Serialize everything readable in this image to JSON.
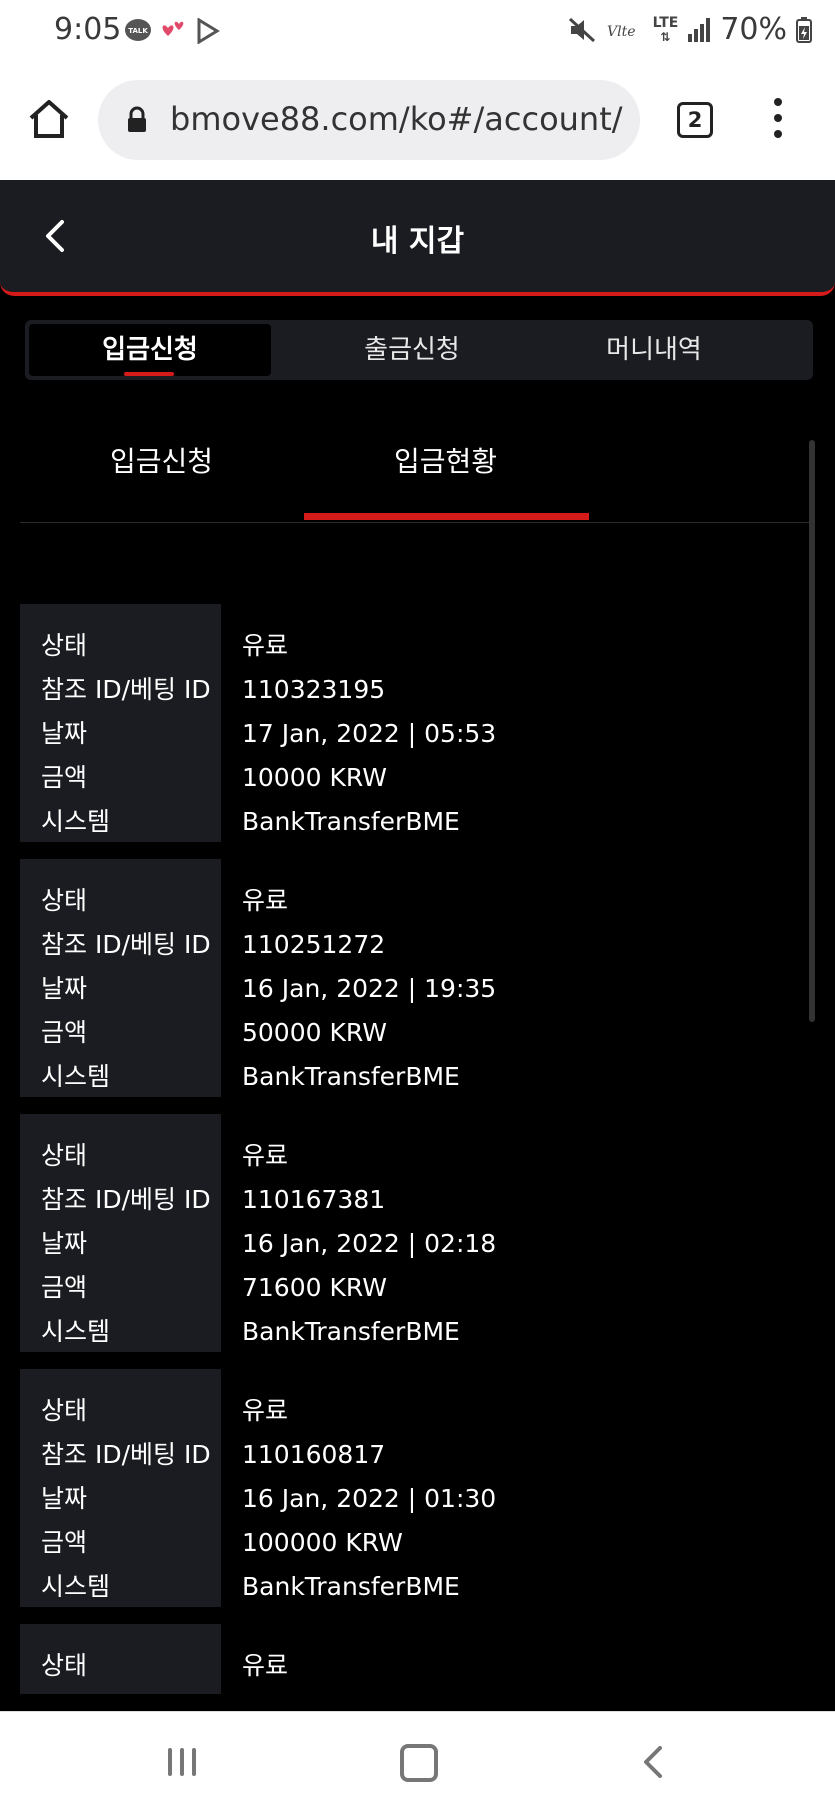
{
  "status_bar": {
    "time": "9:05",
    "battery": "70%",
    "network": "LTE",
    "talk_label": "TALK"
  },
  "browser": {
    "url": "bmove88.com/ko#/account/",
    "tab_count": "2"
  },
  "header": {
    "title": "내 지갑"
  },
  "main_tabs": [
    {
      "label": "입금신청",
      "active": true
    },
    {
      "label": "출금신청",
      "active": false
    },
    {
      "label": "머니내역",
      "active": false
    }
  ],
  "sub_tabs": [
    {
      "label": "입금신청",
      "active": false
    },
    {
      "label": "입금현황",
      "active": true
    }
  ],
  "field_labels": {
    "status": "상태",
    "ref_id": "참조 ID/베팅 ID",
    "date": "날짜",
    "amount": "금액",
    "system": "시스템"
  },
  "records": [
    {
      "status": "유료",
      "ref_id": "110323195",
      "date": "17 Jan, 2022 | 05:53",
      "amount": "10000 KRW",
      "system": "BankTransferBME"
    },
    {
      "status": "유료",
      "ref_id": "110251272",
      "date": "16 Jan, 2022 | 19:35",
      "amount": "50000 KRW",
      "system": "BankTransferBME"
    },
    {
      "status": "유료",
      "ref_id": "110167381",
      "date": "16 Jan, 2022 | 02:18",
      "amount": "71600 KRW",
      "system": "BankTransferBME"
    },
    {
      "status": "유료",
      "ref_id": "110160817",
      "date": "16 Jan, 2022 | 01:30",
      "amount": "100000 KRW",
      "system": "BankTransferBME"
    },
    {
      "status": "유료"
    }
  ],
  "colors": {
    "accent": "#d51a1a",
    "panel": "#1b1c21",
    "background": "#000000"
  }
}
